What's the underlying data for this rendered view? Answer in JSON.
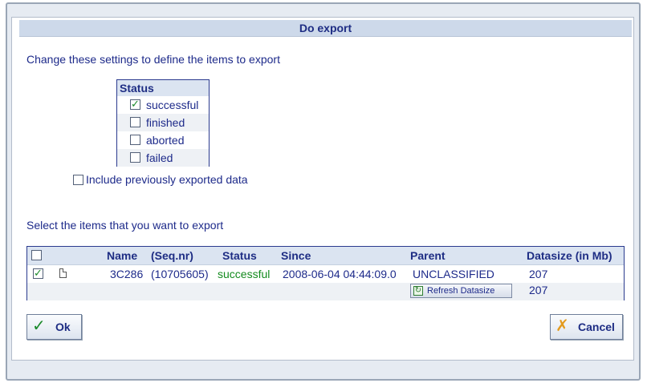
{
  "dialog": {
    "title": "Do export",
    "intro": "Change these settings to define the items to export",
    "select_prompt": "Select the items that you want to export",
    "include_previous_label": "Include previously exported data",
    "include_previous_checked": false
  },
  "status_filter": {
    "header": "Status",
    "options": [
      {
        "label": "successful",
        "checked": true
      },
      {
        "label": "finished",
        "checked": false
      },
      {
        "label": "aborted",
        "checked": false
      },
      {
        "label": "failed",
        "checked": false
      }
    ]
  },
  "grid": {
    "columns": [
      "Name",
      "(Seq.nr)",
      "Status",
      "Since",
      "Parent",
      "Datasize (in Mb)"
    ],
    "rows": [
      {
        "checked": true,
        "name": "3C286",
        "seq": "(10705605)",
        "status": "successful",
        "since": "2008-06-04 04:44:09.0",
        "parent": "UNCLASSIFIED",
        "datasize": "207"
      }
    ],
    "refresh_label": "Refresh Datasize",
    "total_datasize": "207"
  },
  "buttons": {
    "ok": "Ok",
    "cancel": "Cancel"
  },
  "colors": {
    "text_blue": "#1d2a8a",
    "header_bg": "#dbe4f1",
    "status_green": "#138a1e"
  },
  "icons": {
    "ok": "checkmark-icon",
    "cancel": "x-icon",
    "refresh": "refresh-icon",
    "document": "document-icon"
  }
}
